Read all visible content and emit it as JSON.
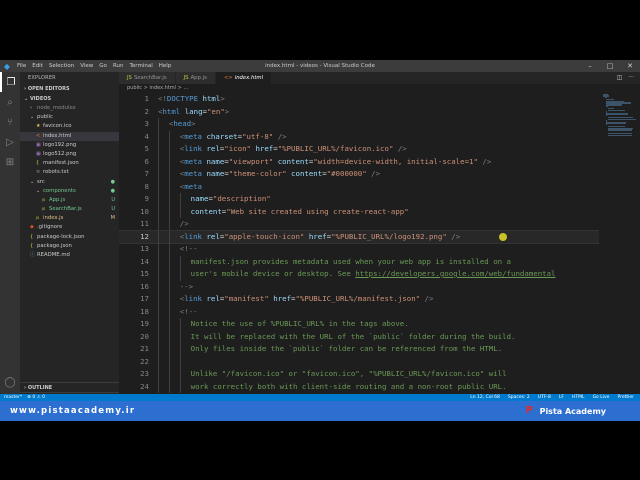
{
  "window": {
    "title": "index.html - videos - Visual Studio Code",
    "menu": [
      "File",
      "Edit",
      "Selection",
      "View",
      "Go",
      "Run",
      "Terminal",
      "Help"
    ]
  },
  "sidebar": {
    "title": "EXPLORER",
    "open_editors": "OPEN EDITORS",
    "project": "VIDEOS",
    "tree": [
      {
        "label": "node_modules",
        "icon": "chevron-right",
        "depth": 1,
        "muted": true
      },
      {
        "label": "public",
        "icon": "chevron-down",
        "depth": 1
      },
      {
        "label": "favicon.ico",
        "icon": "star",
        "depth": 2
      },
      {
        "label": "index.html",
        "icon": "html",
        "depth": 2,
        "selected": true
      },
      {
        "label": "logo192.png",
        "icon": "image",
        "depth": 2
      },
      {
        "label": "logo512.png",
        "icon": "image",
        "depth": 2
      },
      {
        "label": "manifest.json",
        "icon": "json",
        "depth": 2
      },
      {
        "label": "robots.txt",
        "icon": "text",
        "depth": 2
      },
      {
        "label": "src",
        "icon": "chevron-down",
        "depth": 1,
        "status": "●"
      },
      {
        "label": "components",
        "icon": "chevron-down",
        "depth": 2,
        "status": "●",
        "green": true
      },
      {
        "label": "App.js",
        "icon": "js",
        "depth": 3,
        "status": "U",
        "green": true
      },
      {
        "label": "SearchBar.js",
        "icon": "js",
        "depth": 3,
        "status": "U",
        "green": true
      },
      {
        "label": "index.js",
        "icon": "js",
        "depth": 2,
        "status": "M",
        "yellow": true
      },
      {
        "label": ".gitignore",
        "icon": "git",
        "depth": 1
      },
      {
        "label": "package-lock.json",
        "icon": "json",
        "depth": 1
      },
      {
        "label": "package.json",
        "icon": "json",
        "depth": 1
      },
      {
        "label": "README.md",
        "icon": "info",
        "depth": 1
      }
    ],
    "bottom": [
      "OUTLINE",
      "TIMELINE",
      "NPM SCRIPTS"
    ]
  },
  "tabs": [
    {
      "label": "SearchBar.js",
      "icon": "js"
    },
    {
      "label": "App.js",
      "icon": "js"
    },
    {
      "label": "index.html",
      "icon": "html",
      "active": true
    }
  ],
  "breadcrumb": "public > index.html > ...",
  "code": {
    "lines": [
      {
        "n": "1",
        "indent": 0,
        "tokens": [
          [
            "br",
            "<!"
          ],
          [
            "tag",
            "DOCTYPE"
          ],
          [
            "d",
            " "
          ],
          [
            "attr",
            "html"
          ],
          [
            "br",
            ">"
          ]
        ]
      },
      {
        "n": "2",
        "indent": 0,
        "tokens": [
          [
            "br",
            "<"
          ],
          [
            "tag",
            "html"
          ],
          [
            "d",
            " "
          ],
          [
            "attr",
            "lang"
          ],
          [
            "d",
            "="
          ],
          [
            "str",
            "\"en\""
          ],
          [
            "br",
            ">"
          ]
        ]
      },
      {
        "n": "3",
        "indent": 1,
        "tokens": [
          [
            "br",
            "<"
          ],
          [
            "tag",
            "head"
          ],
          [
            "br",
            ">"
          ]
        ]
      },
      {
        "n": "4",
        "indent": 2,
        "tokens": [
          [
            "br",
            "<"
          ],
          [
            "tag",
            "meta"
          ],
          [
            "d",
            " "
          ],
          [
            "attr",
            "charset"
          ],
          [
            "d",
            "="
          ],
          [
            "str",
            "\"utf-8\""
          ],
          [
            "d",
            " "
          ],
          [
            "br",
            "/>"
          ]
        ]
      },
      {
        "n": "5",
        "indent": 2,
        "tokens": [
          [
            "br",
            "<"
          ],
          [
            "tag",
            "link"
          ],
          [
            "d",
            " "
          ],
          [
            "attr",
            "rel"
          ],
          [
            "d",
            "="
          ],
          [
            "str",
            "\"icon\""
          ],
          [
            "d",
            " "
          ],
          [
            "attr",
            "href"
          ],
          [
            "d",
            "="
          ],
          [
            "str",
            "\"%PUBLIC_URL%/favicon.ico\""
          ],
          [
            "d",
            " "
          ],
          [
            "br",
            "/>"
          ]
        ]
      },
      {
        "n": "6",
        "indent": 2,
        "tokens": [
          [
            "br",
            "<"
          ],
          [
            "tag",
            "meta"
          ],
          [
            "d",
            " "
          ],
          [
            "attr",
            "name"
          ],
          [
            "d",
            "="
          ],
          [
            "str",
            "\"viewport\""
          ],
          [
            "d",
            " "
          ],
          [
            "attr",
            "content"
          ],
          [
            "d",
            "="
          ],
          [
            "str",
            "\"width=device-width, initial-scale=1\""
          ],
          [
            "d",
            " "
          ],
          [
            "br",
            "/>"
          ]
        ]
      },
      {
        "n": "7",
        "indent": 2,
        "tokens": [
          [
            "br",
            "<"
          ],
          [
            "tag",
            "meta"
          ],
          [
            "d",
            " "
          ],
          [
            "attr",
            "name"
          ],
          [
            "d",
            "="
          ],
          [
            "str",
            "\"theme-color\""
          ],
          [
            "d",
            " "
          ],
          [
            "attr",
            "content"
          ],
          [
            "d",
            "="
          ],
          [
            "str",
            "\"#000000\""
          ],
          [
            "d",
            " "
          ],
          [
            "br",
            "/>"
          ]
        ]
      },
      {
        "n": "8",
        "indent": 2,
        "tokens": [
          [
            "br",
            "<"
          ],
          [
            "tag",
            "meta"
          ]
        ]
      },
      {
        "n": "9",
        "indent": 3,
        "tokens": [
          [
            "attr",
            "name"
          ],
          [
            "d",
            "="
          ],
          [
            "str",
            "\"description\""
          ]
        ]
      },
      {
        "n": "10",
        "indent": 3,
        "tokens": [
          [
            "attr",
            "content"
          ],
          [
            "d",
            "="
          ],
          [
            "str",
            "\"Web site created using create-react-app\""
          ]
        ]
      },
      {
        "n": "11",
        "indent": 2,
        "tokens": [
          [
            "br",
            "/>"
          ]
        ]
      },
      {
        "n": "12",
        "indent": 2,
        "current": true,
        "tokens": [
          [
            "br",
            "<"
          ],
          [
            "tag",
            "link"
          ],
          [
            "d",
            " "
          ],
          [
            "attr",
            "rel"
          ],
          [
            "d",
            "="
          ],
          [
            "str",
            "\"apple-touch-icon\""
          ],
          [
            "d",
            " "
          ],
          [
            "attr",
            "href"
          ],
          [
            "d",
            "="
          ],
          [
            "str",
            "\"%PUBLIC_URL%/logo192.png\""
          ],
          [
            "d",
            " "
          ],
          [
            "br",
            "/>"
          ]
        ]
      },
      {
        "n": "13",
        "indent": 2,
        "tokens": [
          [
            "br",
            "<!--"
          ]
        ]
      },
      {
        "n": "14",
        "indent": 3,
        "tokens": [
          [
            "com",
            "manifest.json provides metadata used when your web app is installed on a"
          ]
        ]
      },
      {
        "n": "15",
        "indent": 3,
        "tokens": [
          [
            "com",
            "user's mobile device or desktop. See "
          ],
          [
            "link",
            "https://developers.google.com/web/fundamental"
          ]
        ]
      },
      {
        "n": "16",
        "indent": 2,
        "tokens": [
          [
            "br",
            "-->"
          ]
        ]
      },
      {
        "n": "17",
        "indent": 2,
        "tokens": [
          [
            "br",
            "<"
          ],
          [
            "tag",
            "link"
          ],
          [
            "d",
            " "
          ],
          [
            "attr",
            "rel"
          ],
          [
            "d",
            "="
          ],
          [
            "str",
            "\"manifest\""
          ],
          [
            "d",
            " "
          ],
          [
            "attr",
            "href"
          ],
          [
            "d",
            "="
          ],
          [
            "str",
            "\"%PUBLIC_URL%/manifest.json\""
          ],
          [
            "d",
            " "
          ],
          [
            "br",
            "/>"
          ]
        ]
      },
      {
        "n": "18",
        "indent": 2,
        "tokens": [
          [
            "br",
            "<!--"
          ]
        ]
      },
      {
        "n": "19",
        "indent": 3,
        "tokens": [
          [
            "com",
            "Notice the use of %PUBLIC_URL% in the tags above."
          ]
        ]
      },
      {
        "n": "20",
        "indent": 3,
        "tokens": [
          [
            "com",
            "It will be replaced with the URL of the `public` folder during the build."
          ]
        ]
      },
      {
        "n": "21",
        "indent": 3,
        "tokens": [
          [
            "com",
            "Only files inside the `public` folder can be referenced from the HTML."
          ]
        ]
      },
      {
        "n": "22",
        "indent": 3,
        "tokens": [
          [
            "com",
            ""
          ]
        ]
      },
      {
        "n": "23",
        "indent": 3,
        "tokens": [
          [
            "com",
            "Unlike \"/favicon.ico\" or \"favicon.ico\", \"%PUBLIC_URL%/favicon.ico\" will"
          ]
        ]
      },
      {
        "n": "24",
        "indent": 3,
        "tokens": [
          [
            "com",
            "work correctly both with client-side routing and a non-root public URL."
          ]
        ]
      }
    ]
  },
  "statusbar": {
    "left": [
      "master*",
      "⊗ 0 ⚠ 0"
    ],
    "right": [
      "Ln 12, Col 68",
      "Spaces: 2",
      "UTF-8",
      "LF",
      "HTML",
      "Go Live",
      "Prettier"
    ]
  },
  "banner": {
    "url": "www.pistaacademy.ir",
    "brand": "Pista Academy",
    "logo_letter": "P"
  },
  "colors": {
    "accent": "#007acc",
    "banner": "#2d6fd1",
    "logo": "#e32b2b"
  }
}
